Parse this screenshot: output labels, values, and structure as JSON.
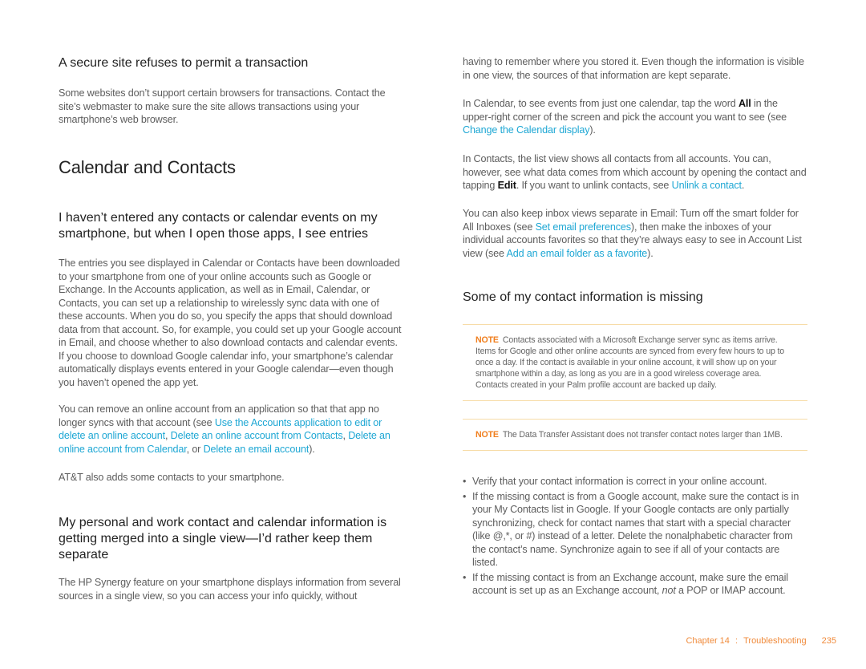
{
  "left": {
    "secure_site": {
      "heading": "A secure site refuses to permit a transaction",
      "body": "Some websites don’t support certain browsers for transactions. Contact the site’s webmaster to make sure the site allows transactions using your smartphone’s web browser."
    },
    "section_title": "Calendar and Contacts",
    "no_entries": {
      "heading": "I haven’t entered any contacts or calendar events on my smartphone, but when I open those apps, I see entries",
      "body": "The entries you see displayed in Calendar or Contacts have been downloaded to your smartphone from one of your online accounts such as Google or Exchange. In the Accounts application, as well as in Email, Calendar, or Contacts, you can set up a relationship to wirelessly sync data with one of these accounts. When you do so, you specify the apps that should download data from that account. So, for example, you could set up your Google account in Email, and choose whether to also download contacts and calendar events. If you choose to download Google calendar info, your smartphone’s calendar automatically displays events entered in your Google calendar—even though you haven’t opened the app yet.",
      "remove_text_1": "You can remove an online account from an application so that that app no longer syncs with that account (see ",
      "link_accounts_app": "Use the Accounts application to edit or delete an online account",
      "sep1": ", ",
      "link_delete_contacts": "Delete an online account from Contacts",
      "sep2": ", ",
      "link_delete_calendar": "Delete an online account from Calendar",
      "sep3": ", or ",
      "link_delete_email": "Delete an email account",
      "remove_text_end": ").",
      "att_text": "AT&T also adds some contacts to your smartphone."
    },
    "merged": {
      "heading": "My personal and work contact and calendar information is getting merged into a single view—I’d rather keep them separate",
      "body_start": "The HP Synergy feature on your smartphone displays information from several sources in a single view, so you can access your info quickly, without"
    }
  },
  "right": {
    "merged_cont": "having to remember where you stored it. Even though the information is visible in one view, the sources of that information are kept separate.",
    "calendar_p": {
      "text_1": "In Calendar, to see events from just one calendar, tap the word ",
      "bold": "All",
      "text_2": " in the upper-right corner of the screen and pick the account you want to see (see ",
      "link": "Change the Calendar display",
      "text_3": ")."
    },
    "contacts_p": {
      "text_1": "In Contacts, the list view shows all contacts from all accounts. You can, however, see what data comes from which account by opening the contact and tapping ",
      "bold": "Edit",
      "text_2": ". If you want to unlink contacts, see ",
      "link": "Unlink a contact",
      "text_3": "."
    },
    "email_p": {
      "text_1": "You can also keep inbox views separate in Email: Turn off the smart folder for All Inboxes (see ",
      "link1": "Set email preferences",
      "text_2": "), then make the inboxes of your individual accounts favorites so that they’re always easy to see in Account List view (see ",
      "link2": "Add an email folder as a favorite",
      "text_3": ")."
    },
    "missing": {
      "heading": "Some of my contact information is missing",
      "note1_label": "NOTE",
      "note1_text": "Contacts associated with a Microsoft Exchange server sync as items arrive. Items for Google and other online accounts are synced from every few hours to up to once a day. If the contact is available in your online account, it will show up on your smartphone within a day, as long as you are in a good wireless coverage area. Contacts created in your Palm profile account are backed up daily.",
      "note2_label": "NOTE",
      "note2_text": "The Data Transfer Assistant does not transfer contact notes larger than 1MB.",
      "bullet_char": "•",
      "bullets": [
        "Verify that your contact information is correct in your online account.",
        "If the missing contact is from a Google account, make sure the contact is in your My Contacts list in Google. If your Google contacts are only partially synchronizing, check for contact names that start with a special character (like @,*, or #) instead of a letter. Delete the nonalphabetic character from the contact’s name. Synchronize again to see if all of your contacts are listed."
      ],
      "bullet3_text_1": "If the missing contact is from an Exchange account, make sure the email account is set up as an Exchange account, ",
      "bullet3_italic": "not",
      "bullet3_text_2": " a POP or IMAP account."
    }
  },
  "footer": {
    "chapter": "Chapter 14",
    "sep": ":",
    "title": "Troubleshooting",
    "page": "235"
  }
}
